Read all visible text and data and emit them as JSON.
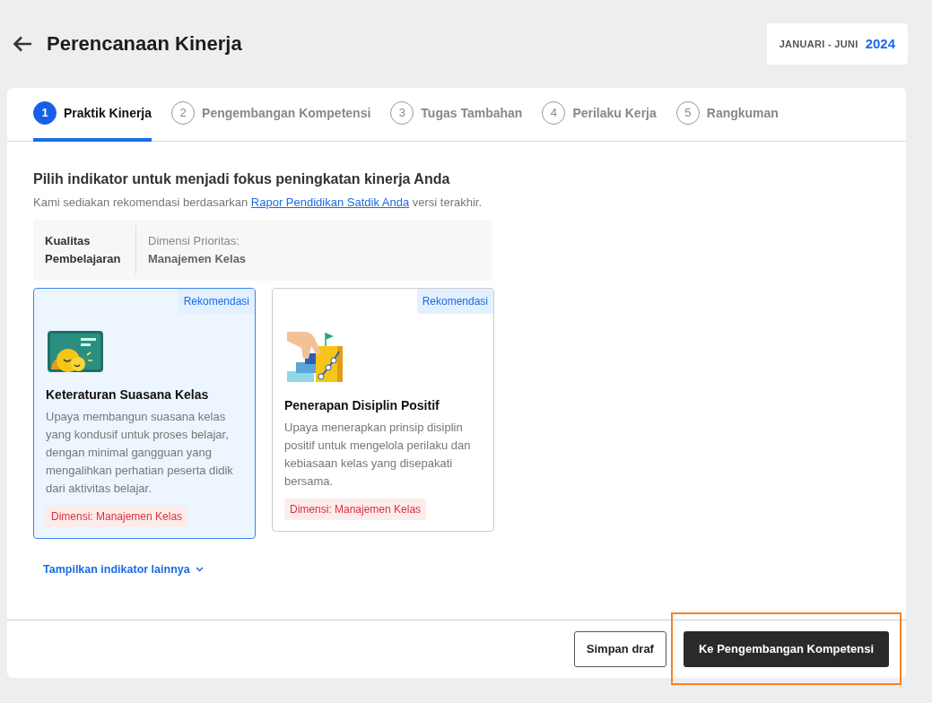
{
  "header": {
    "title": "Perencanaan Kinerja",
    "period": {
      "label": "JANUARI - JUNI",
      "year": "2024"
    }
  },
  "steps": [
    {
      "number": "1",
      "label": "Praktik Kinerja",
      "selected": true
    },
    {
      "number": "2",
      "label": "Pengembangan Kompetensi",
      "selected": false
    },
    {
      "number": "3",
      "label": "Tugas Tambahan",
      "selected": false
    },
    {
      "number": "4",
      "label": "Perilaku Kerja",
      "selected": false
    },
    {
      "number": "5",
      "label": "Rangkuman",
      "selected": false
    }
  ],
  "section": {
    "heading": "Pilih indikator untuk menjadi fokus peningkatan kinerja Anda",
    "intro_before": "Kami sediakan rekomendasi berdasarkan",
    "intro_link": "Rapor Pendidikan Satdik Anda",
    "intro_after": "versi terakhir."
  },
  "priority": {
    "category": "Kualitas Pembelajaran",
    "dimension_label": "Dimensi Prioritas:",
    "dimension": "Manajemen Kelas"
  },
  "indicators": [
    {
      "badge": "Rekomendasi",
      "kind": "classroom",
      "title": "Keteraturan Suasana Kelas",
      "description": "Upaya membangun suasana kelas yang kondusif untuk proses belajar, dengan minimal gangguan yang mengalihkan perhatian peserta didik dari aktivitas belajar.",
      "tag": "Dimensi: Manajemen Kelas",
      "selected": true
    },
    {
      "badge": "Rekomendasi",
      "kind": "stairs",
      "title": "Penerapan Disiplin Positif",
      "description": "Upaya menerapkan prinsip disiplin positif untuk mengelola perilaku dan kebiasaan kelas yang disepakati bersama.",
      "tag": "Dimensi: Manajemen Kelas",
      "selected": false
    }
  ],
  "show_more": "Tampilkan indikator lainnya",
  "footer": {
    "secondary": "Simpan draf",
    "primary": "Ke Pengembangan Kompetensi",
    "primary_highlighted": true
  }
}
